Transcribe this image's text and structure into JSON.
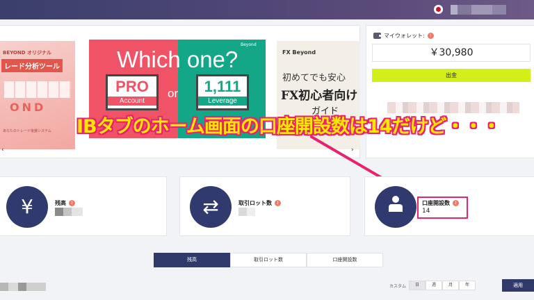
{
  "banner": {
    "slide_left": {
      "brand": "BEYOND オリジナル",
      "title": "レード分析ツール",
      "logo_letters": "OND",
      "caption": "あなたのトレード後援システム"
    },
    "slide_main": {
      "headline": "Which one?",
      "logo": "Beyond",
      "pro_big": "PRO",
      "pro_small": "Account",
      "or": "or",
      "lev_big": "1,111",
      "lev_small": "Leverage"
    },
    "slide_right": {
      "logo": "FX Beyond",
      "line1": "初めてでも安心",
      "line2": "FX初心者向け",
      "line3": "ガイド"
    },
    "prev_arrow": "‹",
    "next_arrow": "›"
  },
  "wallet": {
    "label": "マイウォレット:",
    "info_icon": "!",
    "balance": "￥30,980",
    "deposit_label": "出金"
  },
  "annotation": {
    "text": "IBタブのホーム画面の口座開設数は14だけど・・・",
    "color": "#ffe600",
    "stroke_color": "#e8226e"
  },
  "stats": {
    "balance": {
      "icon": "¥",
      "label": "残高"
    },
    "lots": {
      "icon": "⇄",
      "label": "取引ロット数"
    },
    "accounts": {
      "label": "口座開設数",
      "value": "14"
    }
  },
  "tabs": [
    "残高",
    "取引ロット数",
    "口座開設数"
  ],
  "period": {
    "custom_label": "カスタム",
    "options": [
      "日",
      "週",
      "月",
      "年"
    ],
    "apply_label": "適用"
  },
  "colors": {
    "navy": "#2f3a6b",
    "accent_lime": "#d3ef1a",
    "highlight": "#e8226e"
  }
}
